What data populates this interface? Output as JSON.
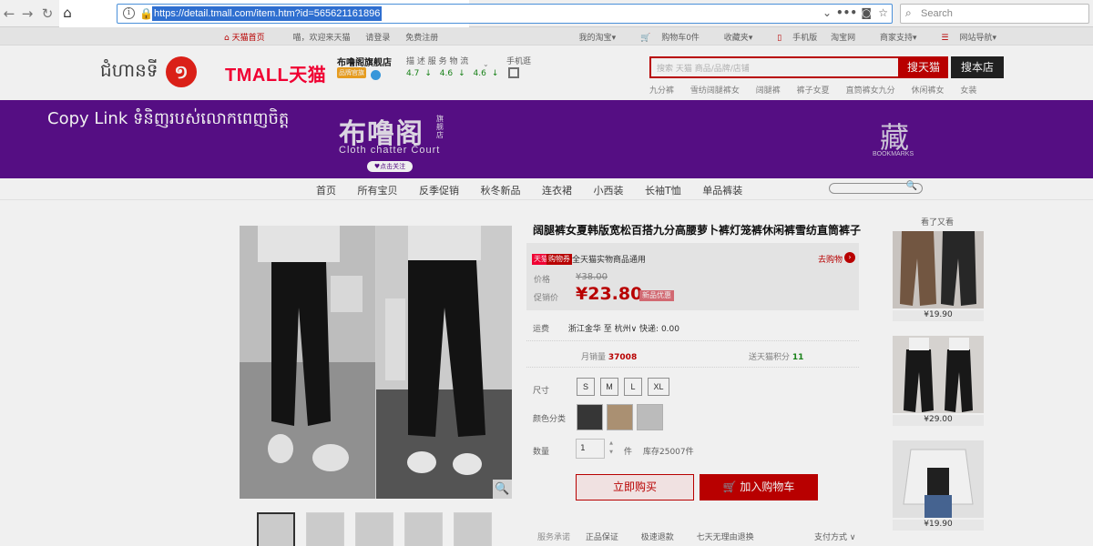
{
  "browser": {
    "url": "https://detail.tmall.com/item.htm?id=565621161896",
    "search_placeholder": "Search"
  },
  "sitebar": {
    "left": [
      "天猫首页",
      "喵，欢迎来天猫",
      "请登录",
      "免费注册"
    ],
    "right": [
      "我的淘宝",
      "购物车0件",
      "收藏夹",
      "手机版",
      "淘宝网",
      "商家支持",
      "网站导航"
    ]
  },
  "header": {
    "episode_text": "ជំហានទី",
    "episode_number": "១",
    "tmall_logo": "TMALL天猫",
    "shop_name": "布噜阁旗舰店",
    "shop_badge": "品牌官旗",
    "rating_labels": "描 述 服 务 物 流",
    "ratings": [
      "4.7",
      "4.6",
      "4.6"
    ],
    "mobile_label": "手机逛",
    "search_placeholder": "搜索 天猫 商品/品牌/店铺",
    "btn_search_tmall": "搜天猫",
    "btn_search_shop": "搜本店",
    "hot_words": [
      "九分裤",
      "雪纺阔腿裤女",
      "阔腿裤",
      "裤子女夏",
      "直筒裤女九分",
      "休闲裤女",
      "女装"
    ]
  },
  "banner": {
    "copy_link_text": "Copy Link ទំនិញរបស់លោកពេញចិត្ត",
    "brand_cn": "布噜阁",
    "brand_tag": "旗舰店",
    "brand_en": "Cloth chatter Court",
    "follow_label": "♥点击关注",
    "bookmark_char": "藏",
    "bookmark_label": "BOOKMARKS"
  },
  "shop_nav": [
    "首页",
    "所有宝贝",
    "反季促销",
    "秋冬新品",
    "连衣裙",
    "小西装",
    "长袖T恤",
    "单品裤装"
  ],
  "product": {
    "title": "阔腿裤女夏韩版宽松百搭九分高腰萝卜裤灯笼裤休闲裤雪纺直筒裤子",
    "tag_tmall": "天猫",
    "tag_voucher": "购物券",
    "voucher_text": "全天猫实物商品通用",
    "get_voucher": "去购物",
    "price_label": "价格",
    "original_price": "¥38.00",
    "promo_price_label": "促销价",
    "current_price": "¥23.80",
    "promo_badge": "新品优惠",
    "shipping_label": "运费",
    "shipping_value": "浙江金华 至 杭州∨ 快递: 0.00",
    "monthly_sales_label": "月销量",
    "monthly_sales": "37008",
    "points_label": "送天猫积分",
    "points": "11",
    "size_label": "尺寸",
    "sizes": [
      "S",
      "M",
      "L",
      "XL"
    ],
    "color_label": "颜色分类",
    "quantity_label": "数量",
    "quantity": "1",
    "quantity_unit": "件",
    "stock": "库存25007件",
    "buy_now": "立即购买",
    "add_to_cart": "加入购物车",
    "service_label": "服务承诺",
    "services": [
      "正品保证",
      "极速退款",
      "七天无理由退换"
    ],
    "payment_label": "支付方式 ∨"
  },
  "recommend": {
    "label": "看了又看",
    "prices": [
      "¥19.90",
      "¥29.00",
      "¥19.90"
    ]
  },
  "colors": {
    "tmall_red": "#c40000",
    "banner_purple": "#5b0f8c"
  }
}
